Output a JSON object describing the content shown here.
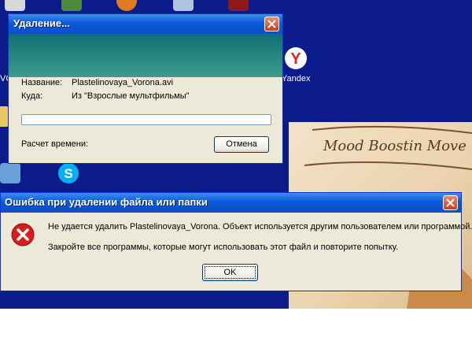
{
  "desktop": {
    "icons": [
      {
        "name": "vc-icon",
        "label": "VC"
      },
      {
        "name": "yandex-icon",
        "label": "Yandex"
      },
      {
        "name": "skype-icon",
        "label": ""
      }
    ],
    "image_caption": "Mood Boostin Move"
  },
  "delete_dialog": {
    "title": "Удаление...",
    "name_label": "Название:",
    "name_value": "Plastelinovaya_Vorona.avi",
    "dest_label": "Куда:",
    "dest_value": "Из \"Взрослые мультфильмы\"",
    "progress": 0,
    "time_label": "Расчет времени:",
    "cancel_label": "Отмена"
  },
  "error_dialog": {
    "title": "Ошибка при удалении файла или папки",
    "message1": "Не удается удалить Plastelinovaya_Vorona. Объект используется другим пользователем или программой.",
    "message2": "Закройте все программы, которые могут использовать этот файл и повторите попытку.",
    "ok_label": "OK"
  }
}
